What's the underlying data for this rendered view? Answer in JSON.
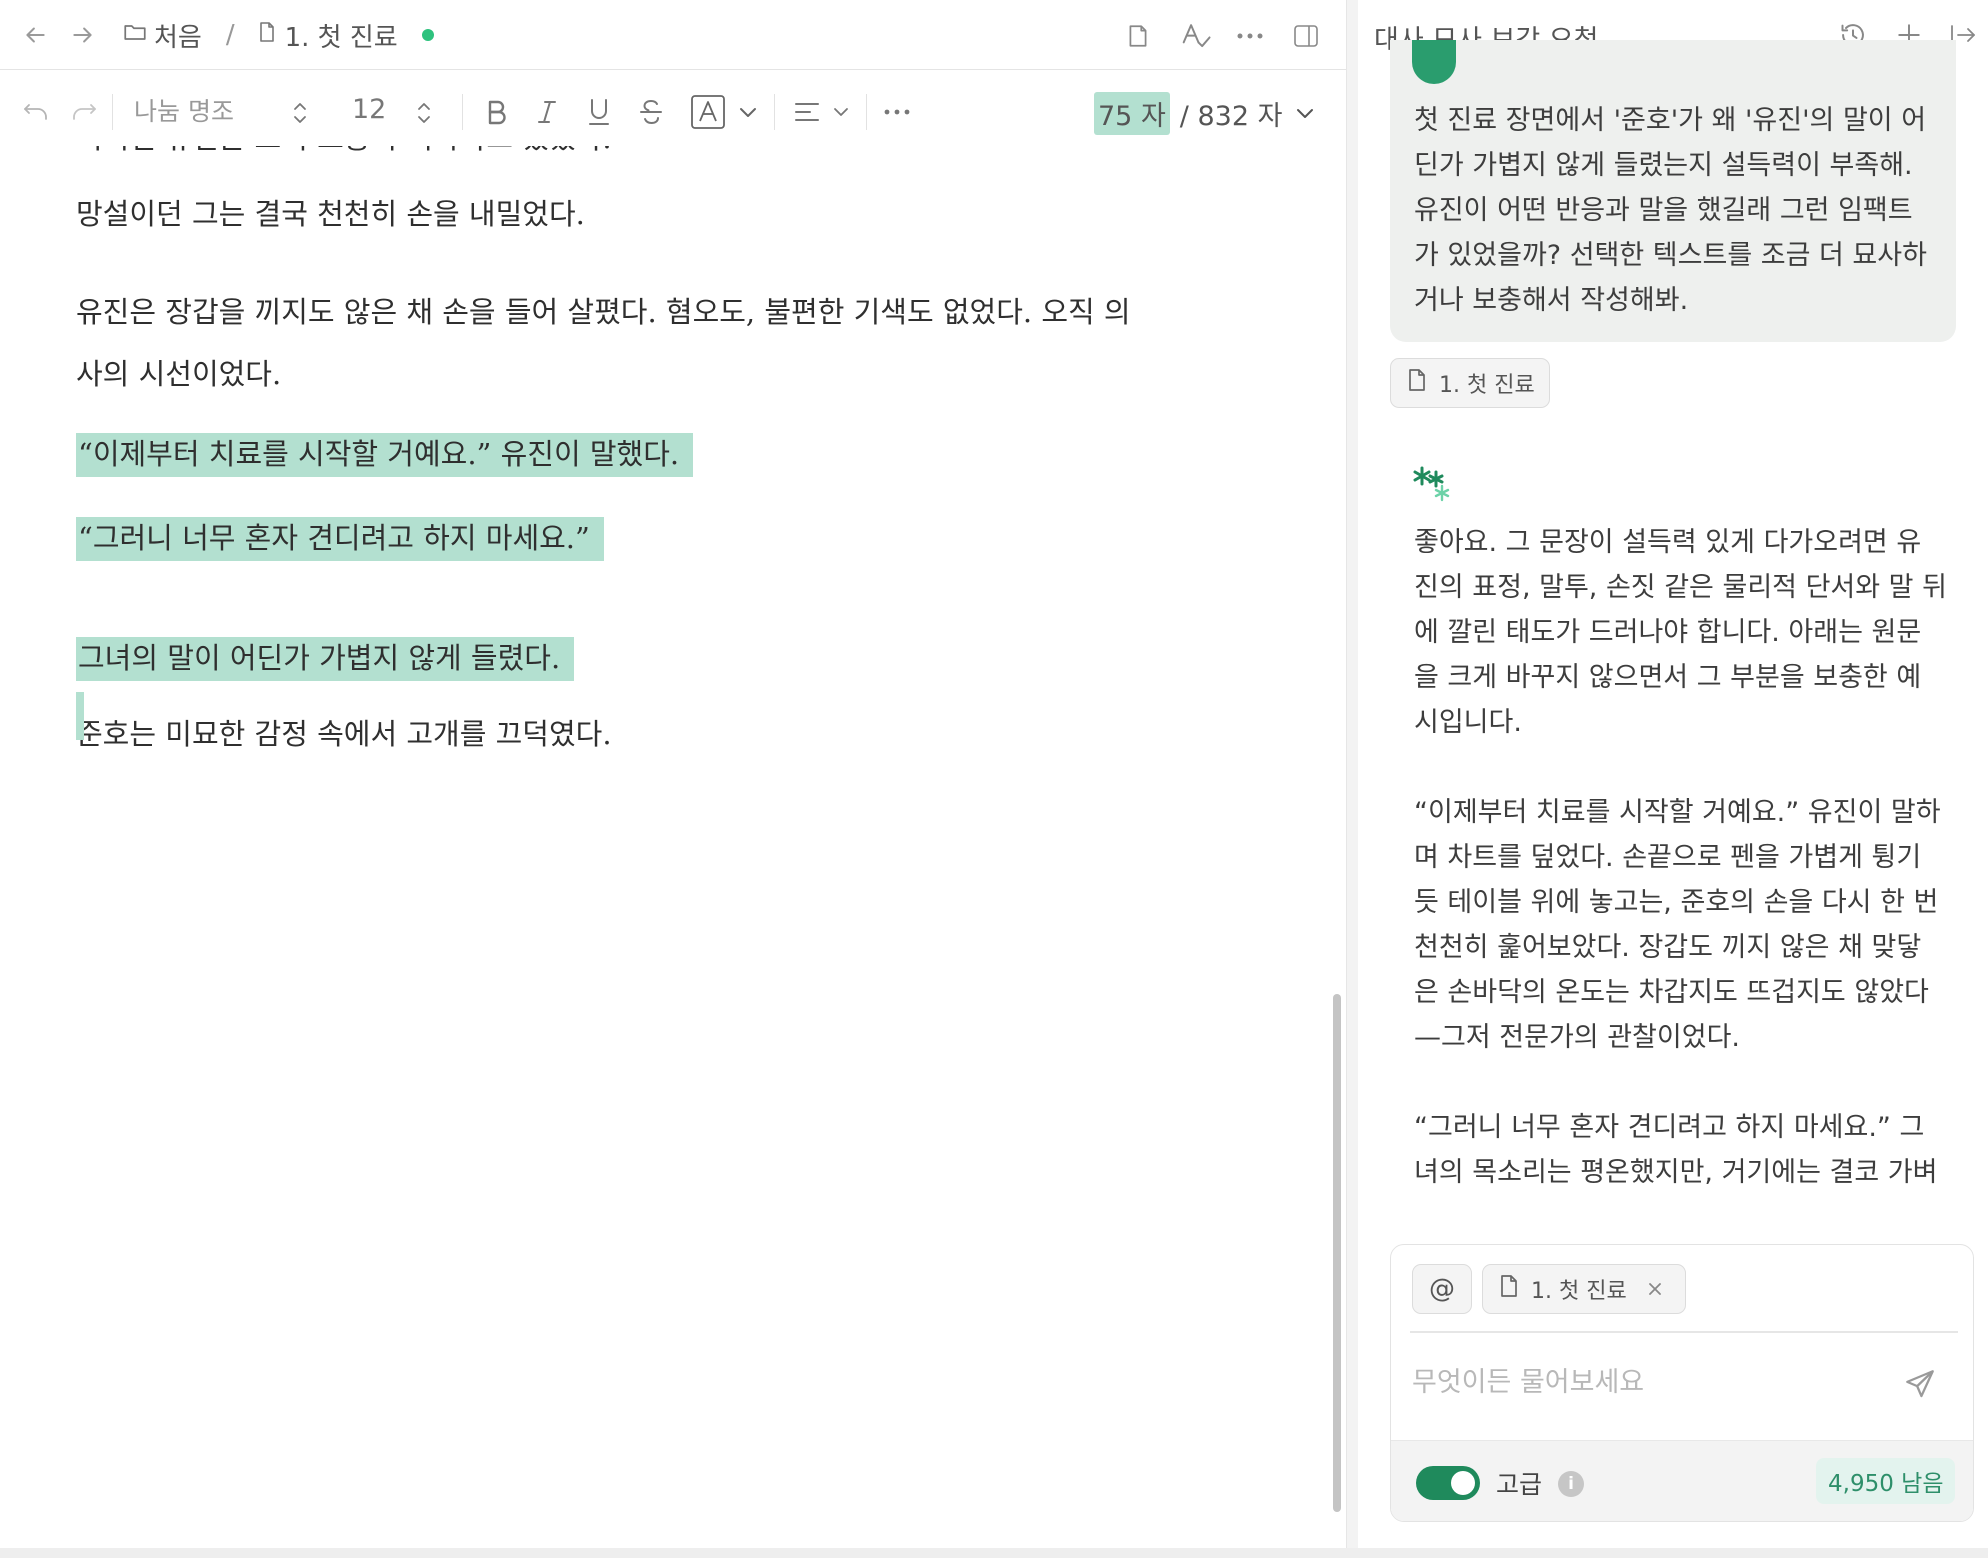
{
  "breadcrumb": {
    "folder": "처음",
    "separator": "/",
    "document": "1. 첫 진료"
  },
  "toolbar": {
    "font_name": "나눔 명조",
    "font_size": "12",
    "char_selected": "75 자",
    "char_total": "/ 832 자"
  },
  "document": {
    "cut_line": "이지킨 유진은 조지 보충이 거나다고 있었다.",
    "p1": "망설이던 그는 결국 천천히 손을 내밀었다.",
    "p2_line1": "유진은 장갑을 끼지도 않은 채 손을 들어 살폈다. 혐오도, 불편한 기색도 없었다. 오직 의",
    "p2_line2": "사의 시선이었다.",
    "sel1": "“이제부터 치료를 시작할 거예요.” 유진이 말했다.",
    "sel2": "“그러니 너무 혼자 견디려고 하지 마세요.”",
    "sel3": "그녀의 말이 어딘가 가볍지 않게 들렸다.",
    "p3": "준호는 미묘한 감정 속에서 고개를 끄덕였다."
  },
  "panel": {
    "title": "대사 묘사 보강 요청",
    "user_message": [
      "첫 진료 장면에서 '준호'가 왜 '유진'의 말이 어",
      "딘가 가볍지 않게 들렸는지 설득력이 부족해.",
      "유진이 어떤 반응과 말을 했길래 그런 임팩트",
      "가 있었을까? 선택한 텍스트를 조금 더 묘사하",
      "거나 보충해서 작성해봐."
    ],
    "attachment": "1. 첫 진료",
    "reply_intro": [
      "좋아요. 그 문장이 설득력 있게 다가오려면 유",
      "진의 표정, 말투, 손짓 같은 물리적 단서와 말 뒤",
      "에 깔린 태도가 드러나야 합니다. 아래는 원문",
      "을 크게 바꾸지 않으면서 그 부분을 보충한 예",
      "시입니다."
    ],
    "reply_para2": [
      "“이제부터 치료를 시작할 거예요.” 유진이 말하",
      "며 차트를 덮었다. 손끝으로 펜을 가볍게 튕기",
      "듯 테이블 위에 놓고는, 준호의 손을 다시 한 번",
      "천천히 훑어보았다. 장갑도 끼지 않은 채 맞닿",
      "은 손바닥의 온도는 차갑지도 뜨겁지도 않았다",
      "—그저 전문가의 관찰이었다."
    ],
    "reply_para3": [
      "“그러니 너무 혼자 견디려고 하지 마세요.” 그",
      "녀의 목소리는 평온했지만, 거기에는 결코 가벼"
    ],
    "mention_symbol": "@",
    "context_chip": "1. 첫 진료",
    "input_placeholder": "무엇이든 물어보세요",
    "advanced_label": "고급",
    "advanced_on": true,
    "remaining": "4,950 남음"
  },
  "colors": {
    "accent": "#1f8a5c",
    "selection": "#b3e0d0",
    "status_dot": "#2ec27e"
  }
}
